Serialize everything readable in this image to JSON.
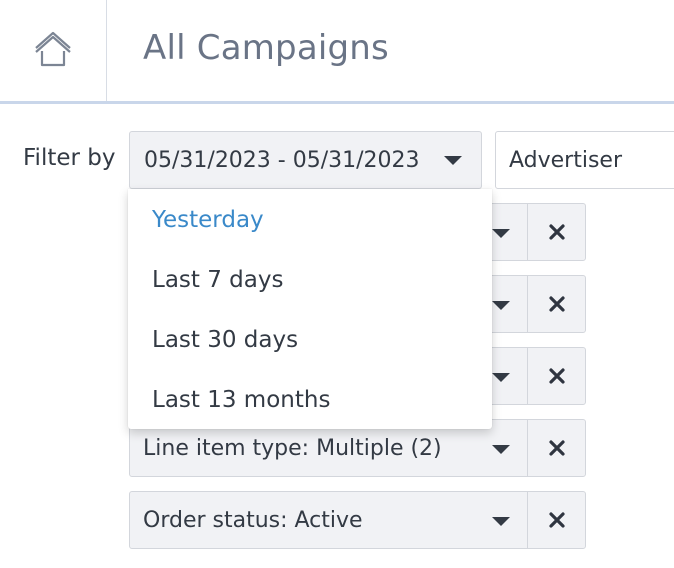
{
  "header": {
    "title": "All Campaigns",
    "home_icon": "home-icon"
  },
  "filters": {
    "label": "Filter by",
    "date_range": {
      "value": "05/31/2023 - 05/31/2023"
    },
    "advertiser": {
      "value": "Advertiser"
    },
    "chips": [
      {
        "label": ""
      },
      {
        "label": ""
      },
      {
        "label": ""
      },
      {
        "label": "Line item type: Multiple (2)"
      },
      {
        "label": "Order status: Active"
      }
    ]
  },
  "date_dropdown": {
    "options": [
      "Yesterday",
      "Last 7 days",
      "Last 30 days",
      "Last 13 months"
    ],
    "highlighted": "Yesterday"
  },
  "colors": {
    "accent": "#3a89c9",
    "title": "#6a7486",
    "text": "#333a44",
    "field_bg": "#f1f2f5",
    "header_rule": "#c9d6ea"
  }
}
